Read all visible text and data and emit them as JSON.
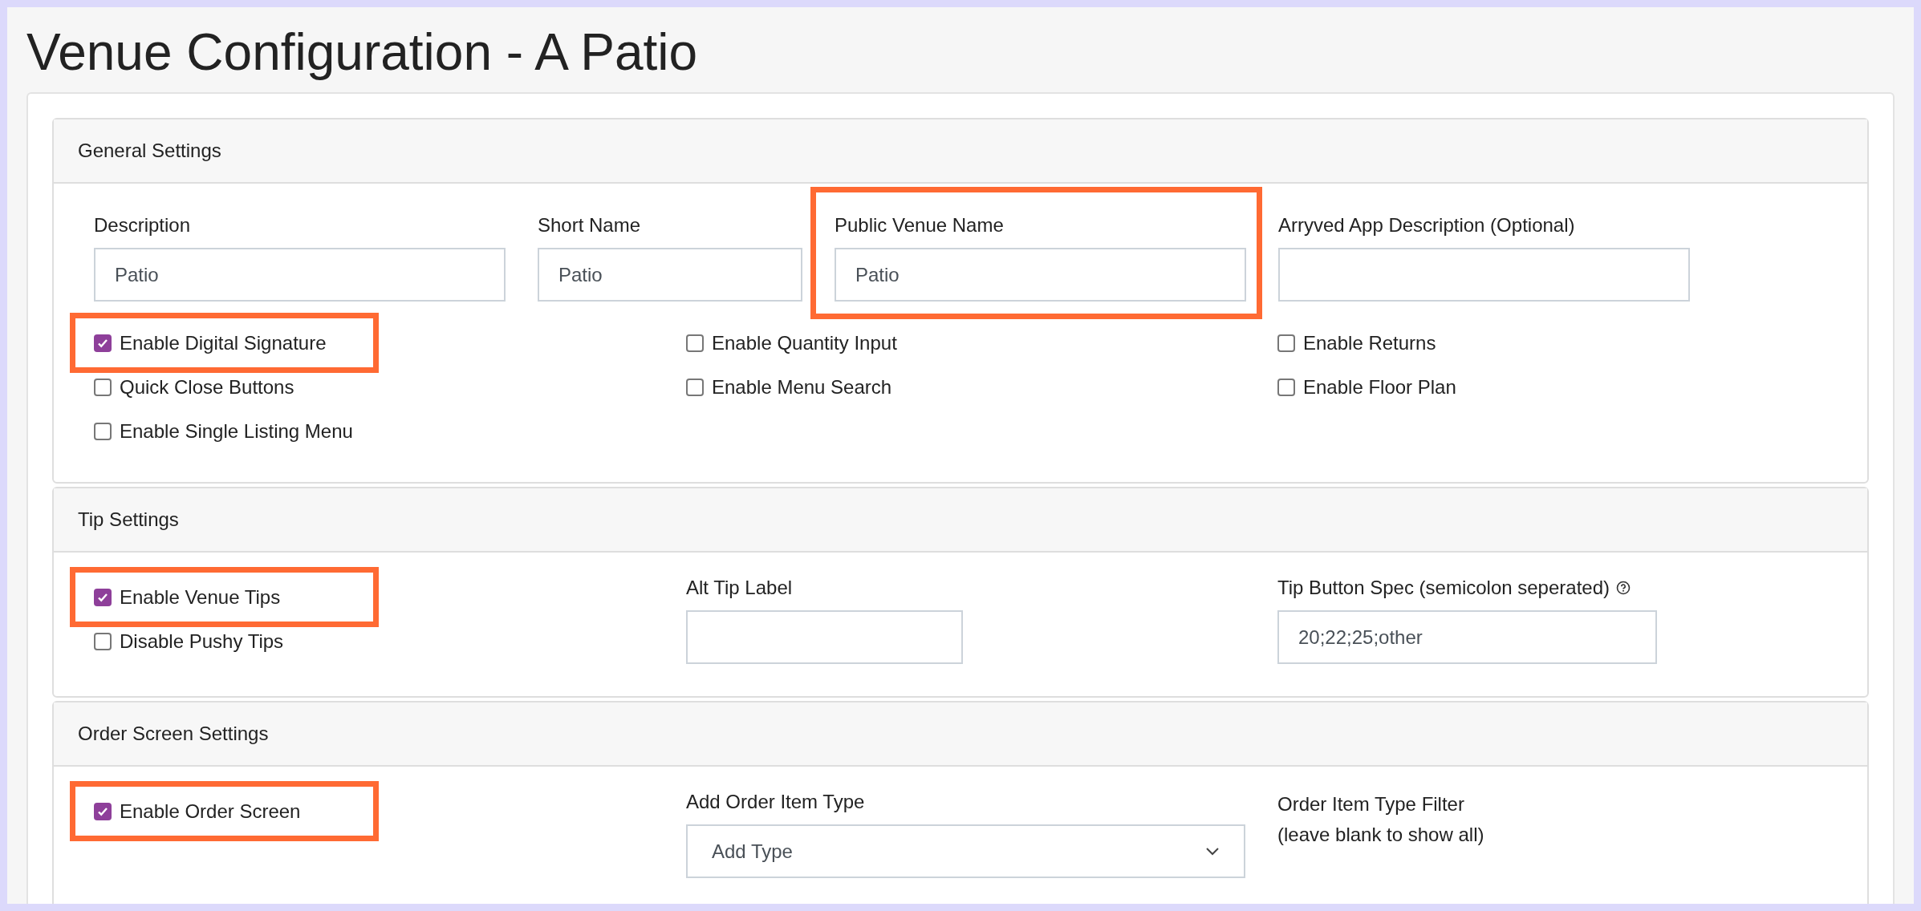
{
  "title": "Venue Configuration - A Patio",
  "sections": [
    {
      "title": "General Settings",
      "fields": [
        {
          "kind": "text",
          "label": "Description",
          "value": "Patio",
          "highlighted": false
        },
        {
          "kind": "text",
          "label": "Short Name",
          "value": "Patio",
          "highlighted": false
        },
        {
          "kind": "text",
          "label": "Public Venue Name",
          "value": "Patio",
          "highlighted": true
        },
        {
          "kind": "text",
          "label": "Arryved App Description (Optional)",
          "highlighted": false
        }
      ],
      "columns": [
        [
          {
            "kind": "checkbox",
            "label": "Enable Digital Signature",
            "checked": true,
            "highlighted": true
          },
          {
            "kind": "checkbox",
            "label": "Quick Close Buttons",
            "checked": false,
            "highlighted": false
          },
          {
            "kind": "checkbox",
            "label": "Enable Single Listing Menu",
            "checked": false,
            "highlighted": false
          }
        ],
        [
          {
            "kind": "checkbox",
            "label": "Enable Quantity Input",
            "checked": false,
            "highlighted": false
          },
          {
            "kind": "checkbox",
            "label": "Enable Menu Search",
            "checked": false,
            "highlighted": false
          }
        ],
        [
          {
            "kind": "checkbox",
            "label": "Enable Returns",
            "checked": false,
            "highlighted": false
          },
          {
            "kind": "checkbox",
            "label": "Enable Floor Plan",
            "checked": false,
            "highlighted": false
          }
        ]
      ]
    },
    {
      "title": "Tip Settings",
      "columns": [
        [
          {
            "kind": "checkbox",
            "label": "Enable Venue Tips",
            "checked": true,
            "highlighted": true
          },
          {
            "kind": "checkbox",
            "label": "Disable Pushy Tips",
            "checked": false,
            "highlighted": false
          }
        ],
        [
          {
            "kind": "text",
            "label": "Alt Tip Label",
            "highlighted": false
          }
        ],
        [
          {
            "kind": "text",
            "label": "Tip Button Spec (semicolon seperated)",
            "value": "20;22;25;other",
            "help": true,
            "highlighted": false
          }
        ]
      ]
    },
    {
      "title": "Order Screen Settings",
      "columns": [
        [
          {
            "kind": "checkbox",
            "label": "Enable Order Screen",
            "checked": true,
            "highlighted": true
          }
        ],
        [
          {
            "kind": "select",
            "label": "Add Order Item Type",
            "value": "Add Type",
            "highlighted": false
          }
        ],
        [
          {
            "kind": "note",
            "lines": [
              "Order Item Type Filter",
              "(leave blank to show all)"
            ]
          }
        ]
      ]
    }
  ]
}
